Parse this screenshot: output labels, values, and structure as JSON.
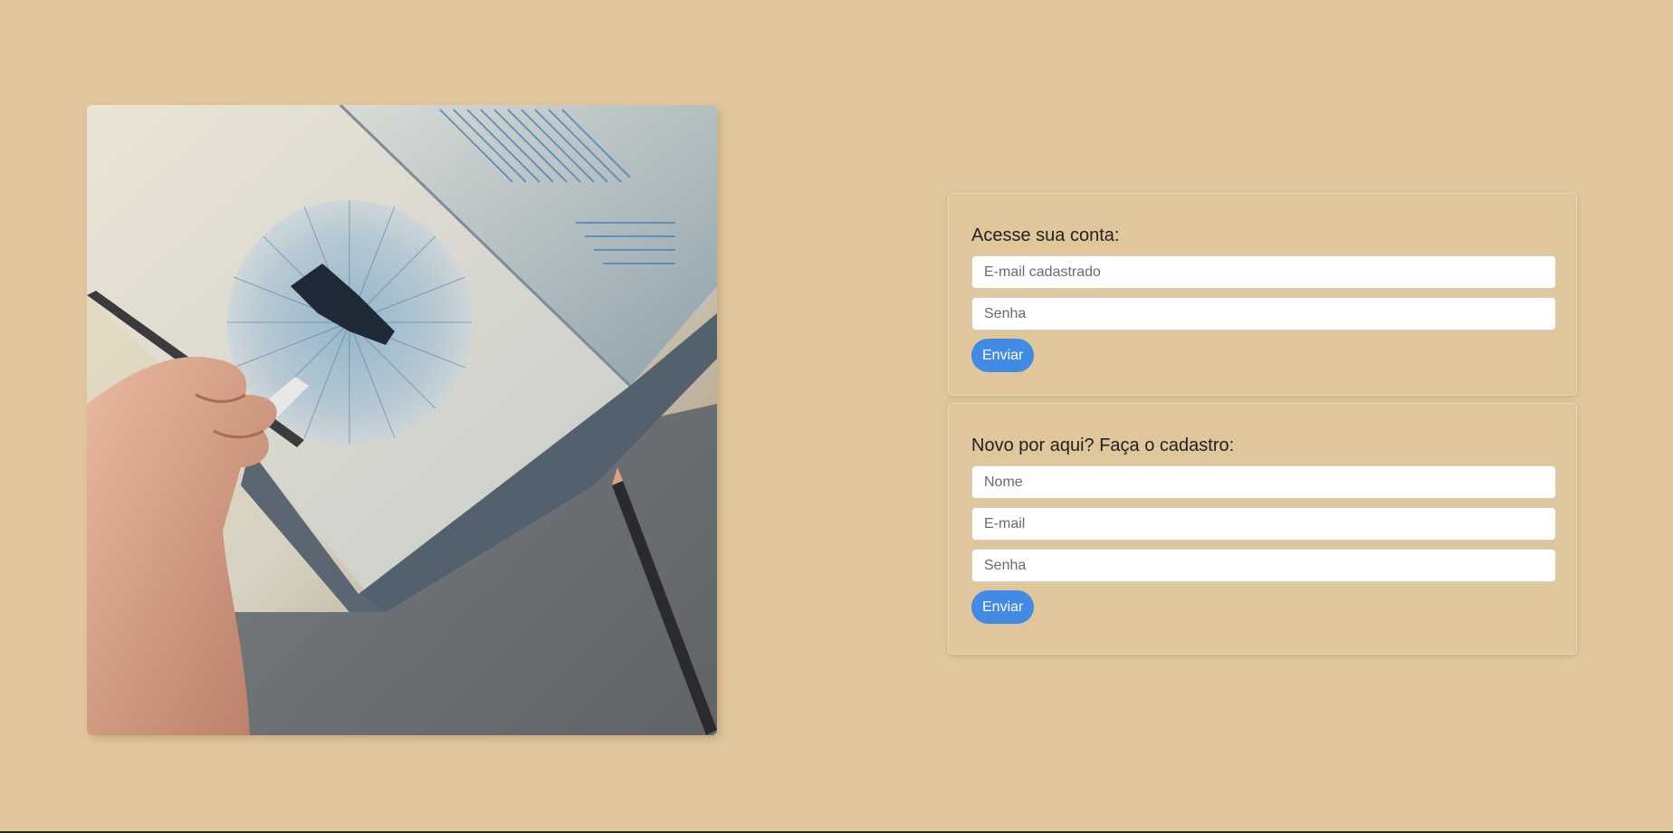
{
  "illustration": {
    "alt": "hand-drawing-notebook-illustration"
  },
  "login": {
    "title": "Acesse sua conta:",
    "email_placeholder": "E-mail cadastrado",
    "password_placeholder": "Senha",
    "submit_label": "Enviar"
  },
  "signup": {
    "title": "Novo por aqui? Faça o cadastro:",
    "name_placeholder": "Nome",
    "email_placeholder": "E-mail",
    "password_placeholder": "Senha",
    "submit_label": "Enviar"
  },
  "colors": {
    "background": "#e0c79c",
    "accent": "#418be6"
  }
}
